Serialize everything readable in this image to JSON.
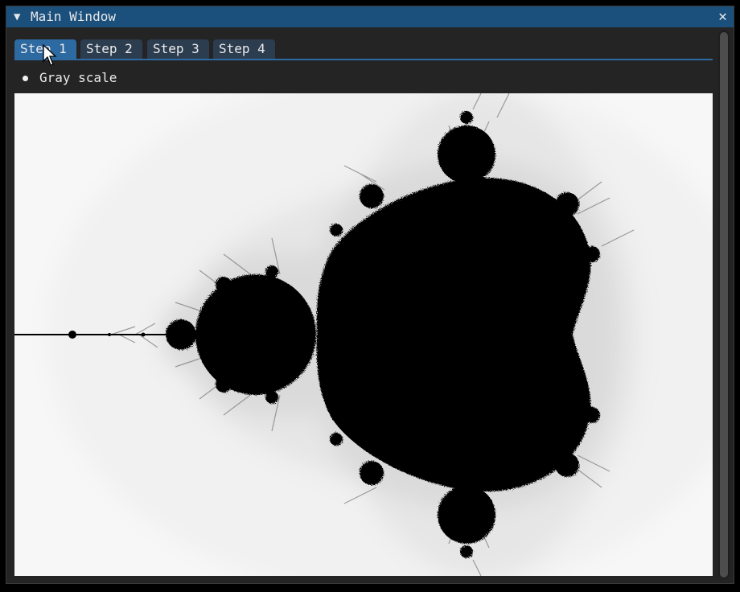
{
  "window": {
    "title": "Main Window",
    "collapse_icon": "triangle-down-icon",
    "close_glyph": "✕",
    "close_icon": "close-icon"
  },
  "tabs": [
    {
      "label": "Step 1",
      "active": true
    },
    {
      "label": "Step 2",
      "active": false
    },
    {
      "label": "Step 3",
      "active": false
    },
    {
      "label": "Step 4",
      "active": false
    }
  ],
  "options": {
    "gray_scale_label": "Gray scale",
    "gray_scale_selected": true
  },
  "colors": {
    "titlebar": "#1b507d",
    "tab_active": "#2e6aa2",
    "tab_inactive": "#2c3d50",
    "window_bg": "#242424",
    "fractal_set": "#000000",
    "fractal_background": "#f7f7f7"
  }
}
